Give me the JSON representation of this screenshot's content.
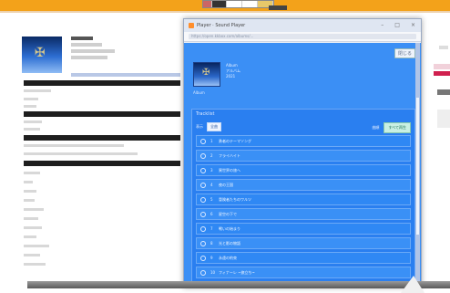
{
  "window": {
    "title": "Player · Sound Player",
    "url": "https://open.kkbox.com/albums/...",
    "controls": [
      "–",
      "□",
      "×"
    ]
  },
  "modal": {
    "close_label": "閉じる",
    "album_meta_1": "Album",
    "album_meta_2": "アルバム",
    "album_meta_3": "2021",
    "album_tag": "Album",
    "panel_title": "Tracklist",
    "control_label": "表示",
    "control_select": "全曲",
    "control_note": "曲順",
    "control_button": "すべて再生"
  },
  "tracks": [
    {
      "num": "1",
      "title": "勇者のテーマソング"
    },
    {
      "num": "2",
      "title": "フライハイト"
    },
    {
      "num": "3",
      "title": "異世界の旅へ"
    },
    {
      "num": "4",
      "title": "夜の王国"
    },
    {
      "num": "5",
      "title": "冒険者たちのワルツ"
    },
    {
      "num": "6",
      "title": "星空の下で"
    },
    {
      "num": "7",
      "title": "戦いの始まり"
    },
    {
      "num": "8",
      "title": "光と影の物語"
    },
    {
      "num": "9",
      "title": "永遠の約束"
    },
    {
      "num": "10",
      "title": "フィナーレ ~旅立ち~"
    }
  ]
}
